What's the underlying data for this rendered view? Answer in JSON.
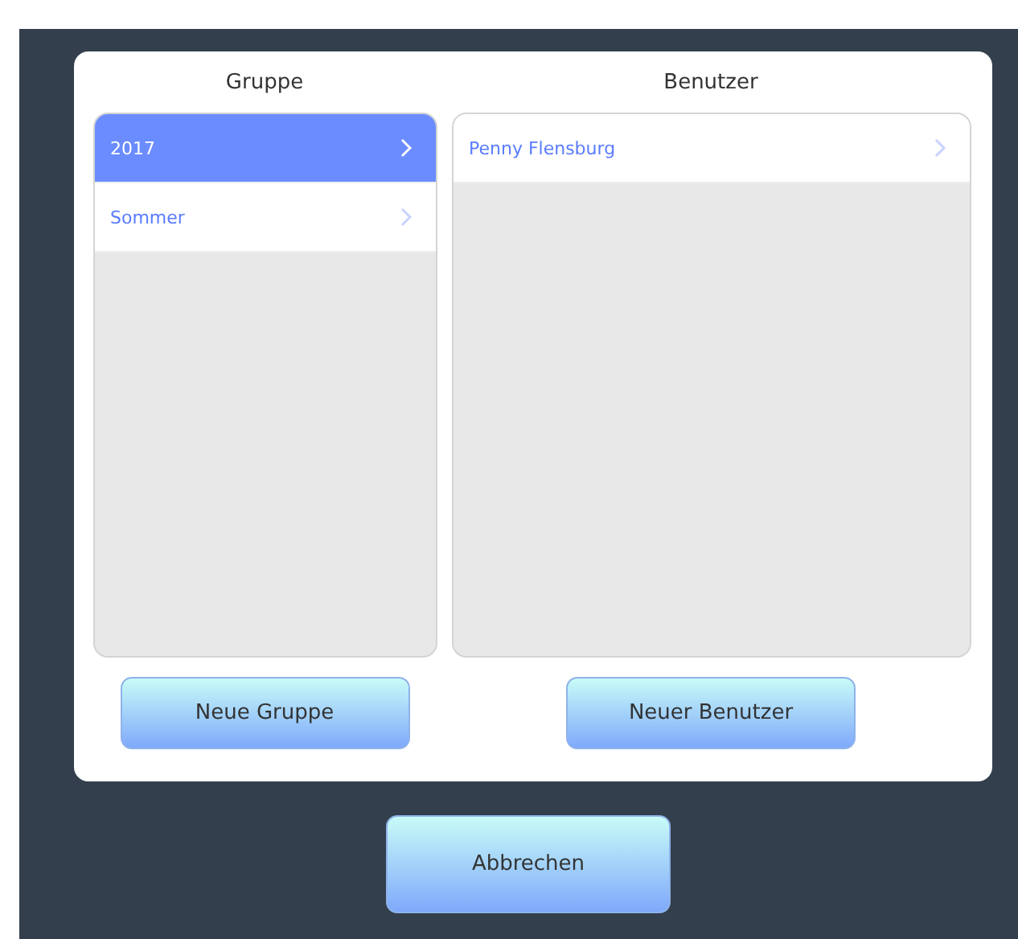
{
  "dialog": {
    "columns": [
      {
        "title": "Gruppe",
        "items": [
          {
            "label": "2017",
            "selected": true
          },
          {
            "label": "Sommer",
            "selected": false
          }
        ],
        "button": "Neue Gruppe"
      },
      {
        "title": "Benutzer",
        "items": [
          {
            "label": "Penny Flensburg",
            "selected": false
          }
        ],
        "button": "Neuer Benutzer"
      }
    ]
  },
  "cancel_button": "Abbrechen"
}
